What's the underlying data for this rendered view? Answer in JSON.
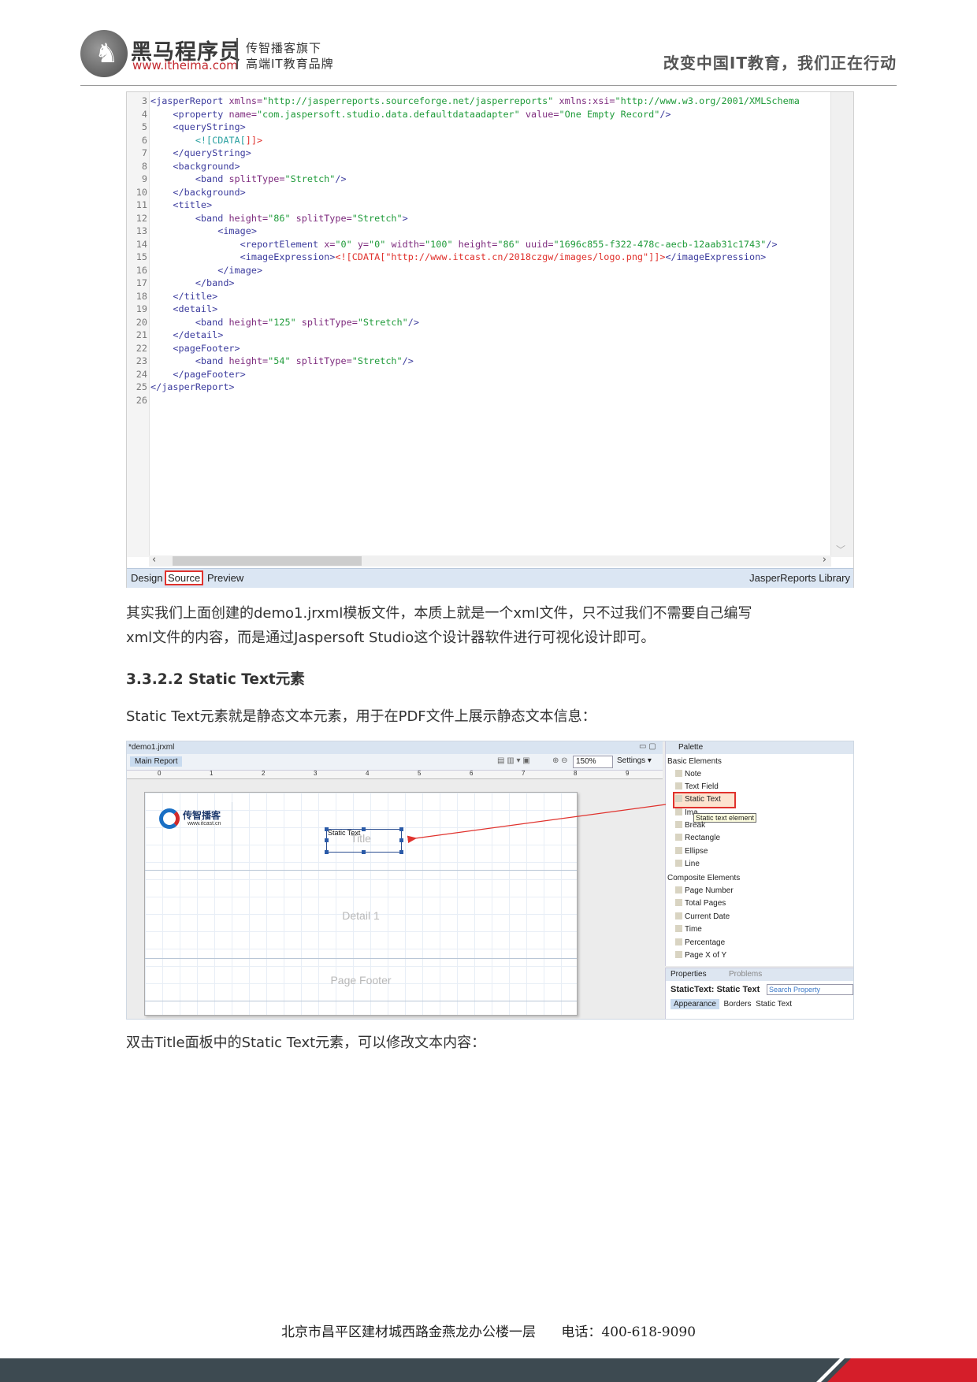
{
  "header": {
    "brand": "黑马程序员",
    "url": "www.itheima.com",
    "slogan_line1": "传智播客旗下",
    "slogan_line2": "高端IT教育品牌",
    "motto": "改变中国IT教育，我们正在行动"
  },
  "editor": {
    "lines": [
      {
        "n": "3"
      },
      {
        "n": "4"
      },
      {
        "n": "5"
      },
      {
        "n": "6"
      },
      {
        "n": "7"
      },
      {
        "n": "8"
      },
      {
        "n": "9"
      },
      {
        "n": "10"
      },
      {
        "n": "11"
      },
      {
        "n": "12"
      },
      {
        "n": "13"
      },
      {
        "n": "14"
      },
      {
        "n": "15"
      },
      {
        "n": "16"
      },
      {
        "n": "17"
      },
      {
        "n": "18"
      },
      {
        "n": "19"
      },
      {
        "n": "20"
      },
      {
        "n": "21"
      },
      {
        "n": "22"
      },
      {
        "n": "23"
      },
      {
        "n": "24"
      },
      {
        "n": "25"
      },
      {
        "n": "26"
      }
    ],
    "code": {
      "l3a": "<jasperReport ",
      "l3b": "xmlns=",
      "l3c": "\"http://jasperreports.sourceforge.net/jasperreports\"",
      "l3d": " xmlns:xsi=",
      "l3e": "\"http://www.w3.org/2001/XMLSchema",
      "l4a": "    <property ",
      "l4b": "name=",
      "l4c": "\"com.jaspersoft.studio.data.defaultdataadapter\"",
      "l4d": " value=",
      "l4e": "\"One Empty Record\"",
      "l4f": "/>",
      "l5": "    <queryString>",
      "l6a": "        <![CDATA[",
      "l6b": "]]>",
      "l7": "    </queryString>",
      "l8": "    <background>",
      "l9a": "        <band ",
      "l9b": "splitType=",
      "l9c": "\"Stretch\"",
      "l9d": "/>",
      "l10": "    </background>",
      "l11": "    <title>",
      "l12a": "        <band ",
      "l12b": "height=",
      "l12c": "\"86\"",
      "l12d": " splitType=",
      "l12e": "\"Stretch\"",
      "l12f": ">",
      "l13": "            <image>",
      "l14a": "                <reportElement ",
      "l14b": "x=",
      "l14c": "\"0\"",
      "l14d": " y=",
      "l14e": "\"0\"",
      "l14f": " width=",
      "l14g": "\"100\"",
      "l14h": " height=",
      "l14i": "\"86\"",
      "l14j": " uuid=",
      "l14k": "\"1696c855-f322-478c-aecb-12aab31c1743\"",
      "l14l": "/>",
      "l15a": "                <imageExpression>",
      "l15b": "<![CDATA[",
      "l15c": "\"http://www.itcast.cn/2018czgw/images/logo.png\"",
      "l15d": "]]>",
      "l15e": "</imageExpression>",
      "l16": "            </image>",
      "l17": "        </band>",
      "l18": "    </title>",
      "l19": "    <detail>",
      "l20a": "        <band ",
      "l20b": "height=",
      "l20c": "\"125\"",
      "l20d": " splitType=",
      "l20e": "\"Stretch\"",
      "l20f": "/>",
      "l21": "    </detail>",
      "l22": "    <pageFooter>",
      "l23a": "        <band ",
      "l23b": "height=",
      "l23c": "\"54\"",
      "l23d": " splitType=",
      "l23e": "\"Stretch\"",
      "l23f": "/>",
      "l24": "    </pageFooter>",
      "l25": "</jasperReport>"
    },
    "tabs": {
      "design": "Design",
      "source": "Source",
      "preview": "Preview",
      "library": "JasperReports Library"
    }
  },
  "body": {
    "para1_line1": "其实我们上面创建的demo1.jrxml模板文件，本质上就是一个xml文件，只不过我们不需要自己编写",
    "para1_line2": "xml文件的内容，而是通过Jaspersoft Studio这个设计器软件进行可视化设计即可。",
    "heading": "3.3.2.2 Static Text元素",
    "para2": "Static Text元素就是静态文本元素，用于在PDF文件上展示静态文本信息：",
    "para3": "双击Title面板中的Static Text元素，可以修改文本内容："
  },
  "designer": {
    "file_tab": "*demo1.jrxml",
    "main_report": "Main Report",
    "zoom": "150%",
    "settings": "Settings",
    "ruler": [
      "0",
      "1",
      "2",
      "3",
      "4",
      "5",
      "6",
      "7",
      "8",
      "9"
    ],
    "logo_text": "传智播客",
    "logo_url": "www.itcast.cn",
    "static_text_label": "Static Text",
    "band_title": "Title",
    "band_detail": "Detail 1",
    "band_footer": "Page Footer",
    "palette": {
      "title": "Palette",
      "basic": "Basic Elements",
      "basic_items": [
        "Note",
        "Text Field",
        "Static Text",
        "Ima",
        "Break",
        "Rectangle",
        "Ellipse",
        "Line"
      ],
      "tooltip": "Static text element",
      "composite": "Composite Elements",
      "composite_items": [
        "Page Number",
        "Total Pages",
        "Current Date",
        "Time",
        "Percentage",
        "Page X of Y"
      ]
    },
    "properties": {
      "tab": "Properties",
      "problems": "Problems",
      "title": "StaticText: Static Text",
      "search": "Search Property",
      "tabs": [
        "Appearance",
        "Borders",
        "Static Text"
      ]
    }
  },
  "footer": {
    "address": "北京市昌平区建材城西路金燕龙办公楼一层",
    "phone": "电话：400-618-9090"
  }
}
